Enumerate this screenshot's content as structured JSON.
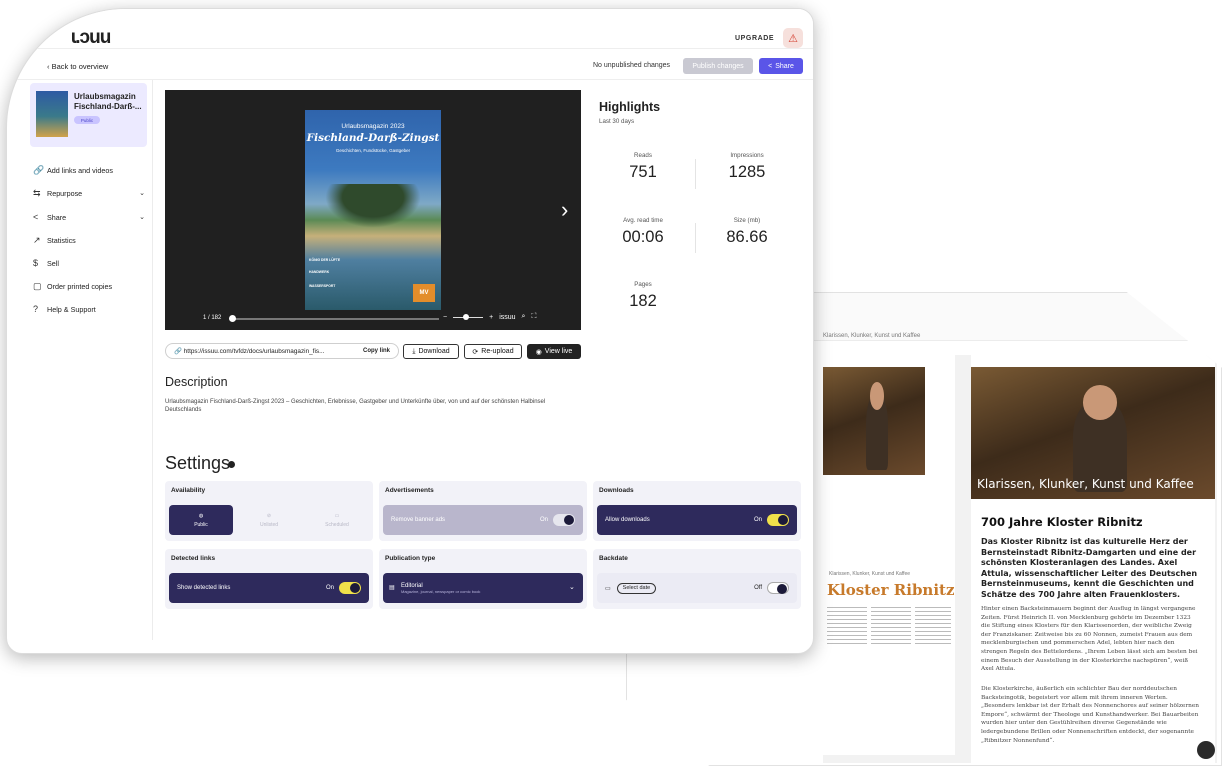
{
  "app": {
    "logo": "ɩ.ɔuu",
    "upgrade_label": "UPGRADE",
    "avatar_glyph": "⚠",
    "brand_color": "#5a55e8",
    "dark_panel_color": "#2e2a5c",
    "toggle_on_color": "#f0e14a"
  },
  "subbar": {
    "back_label": "Back to overview",
    "status_text": "No unpublished changes",
    "publish_label": "Publish changes",
    "share_label": "Share"
  },
  "publication": {
    "title": "Urlaubsmagazin Fischland-Darß-...",
    "badge": "Public"
  },
  "sidebar": {
    "items": [
      {
        "icon": "link-icon",
        "glyph": "🔗",
        "label": "Add links and videos",
        "chevron": false
      },
      {
        "icon": "repurpose-icon",
        "glyph": "⇆",
        "label": "Repurpose",
        "chevron": true
      },
      {
        "icon": "share-icon",
        "glyph": "<",
        "label": "Share",
        "chevron": true
      },
      {
        "icon": "statistics-icon",
        "glyph": "↗",
        "label": "Statistics",
        "chevron": false
      },
      {
        "icon": "dollar-icon",
        "glyph": "$",
        "label": "Sell",
        "chevron": false
      },
      {
        "icon": "print-icon",
        "glyph": "▢",
        "label": "Order printed copies",
        "chevron": false
      },
      {
        "icon": "help-icon",
        "glyph": "?",
        "label": "Help & Support",
        "chevron": false
      }
    ]
  },
  "viewer": {
    "cover_line1": "Urlaubsmagazin 2023",
    "cover_title": "Fischland-Darß-Zingst",
    "cover_sub": "Geschichten, Fundstücke, Gastgeber",
    "cover_blurb1": "KÖNIG DER LÜFTE",
    "cover_blurb2": "HANDWERK",
    "cover_blurb3": "WASSERSPORT",
    "cover_logo": "MV",
    "page_indicator": "1 / 182",
    "brand": "issuu",
    "progress_fraction": 0.0
  },
  "links": {
    "url": "https://issuu.com/tvfdz/docs/urlaubsmagazin_fis...",
    "copy_label": "Copy link",
    "download_label": "Download",
    "reupload_label": "Re-upload",
    "view_live_label": "View live"
  },
  "description": {
    "heading": "Description",
    "text": "Urlaubsmagazin Fischland-Darß-Zingst 2023 – Geschichten, Erlebnisse, Gastgeber und Unterkünfte über, von und auf der schönsten Halbinsel Deutschlands"
  },
  "highlights": {
    "heading": "Highlights",
    "period": "Last 30 days",
    "stats": [
      {
        "label": "Reads",
        "value": "751"
      },
      {
        "label": "Impressions",
        "value": "1285"
      },
      {
        "label": "Avg. read time",
        "value": "00:06"
      },
      {
        "label": "Size (mb)",
        "value": "86.66"
      },
      {
        "label": "Pages",
        "value": "182"
      }
    ]
  },
  "settings": {
    "heading": "Settings",
    "availability": {
      "title": "Availability",
      "options": [
        "Public",
        "Unlisted",
        "Scheduled"
      ],
      "selected": "Public"
    },
    "advertisements": {
      "title": "Advertisements",
      "label": "Remove banner ads",
      "state": "On"
    },
    "downloads": {
      "title": "Downloads",
      "label": "Allow downloads",
      "state": "On"
    },
    "detected_links": {
      "title": "Detected links",
      "label": "Show detected links",
      "state": "On"
    },
    "publication_type": {
      "title": "Publication type",
      "value": "Editorial",
      "sub": "Magazine, journal, newspaper or comic book"
    },
    "backdate": {
      "title": "Backdate",
      "button": "Select date",
      "state": "Off"
    }
  },
  "back_window": {
    "breadcrumb": "Klarissen, Klunker, Kunst und Kaffee",
    "photo_caption": "Klarissen, Klunker, Kunst und Kaffee",
    "article_title": "700 Jahre Kloster Ribnitz",
    "article_lead": "Das Kloster Ribnitz ist das kulturelle Herz der Bernsteinstadt Ribnitz-Damgarten und eine der schönsten Klosteranlagen des Landes. Axel Attula, wissenschaftlicher Leiter des Deutschen Bernsteinmuseums, kennt die Geschichten und Schätze des 700 Jahre alten Frauenklosters.",
    "article_body1": "Hinter einen Backsteinmauern beginnt der Ausflug in längst vergangene Zeiten. Fürst Heinrich II. von Mecklenburg gehörte im Dezember 1323 die Stiftung eines Klosters für den Klarissenorden, der weibliche Zweig der Franziskaner. Zeitweise bis zu 60 Nonnen, zumeist Frauen aus dem mecklenburgischen und pommerschen Adel, lebten hier nach den strengen Regeln des Bettelordens. „Ihrem Leben lässt sich am besten bei einem Besuch der Ausstellung in der Klosterkirche nachspüren“, weiß Axel Attula.",
    "article_body2": "Die Klosterkirche, äußerlich ein schlichter Bau der norddeutschen Backsteingotik, begeistert vor allem mit ihrem inneren Werten. „Besonders lenkbar ist der Erhalt des Nonnenchores auf seiner hölzernen Empore“, schwärmt der Theologe und Kunsthandwerker. Bei Bauarbeiten wurden hier unter den Gestühlreihen diverse Gegenstände wie ledergebundene Brillen oder Nonnenschriften entdeckt, der sogenannte „Ribnitzer Nonnenfund“.",
    "left_small": "Klarissen, Klunker, Kunst und Kaffee",
    "left_title": "Kloster Ribnitz"
  }
}
